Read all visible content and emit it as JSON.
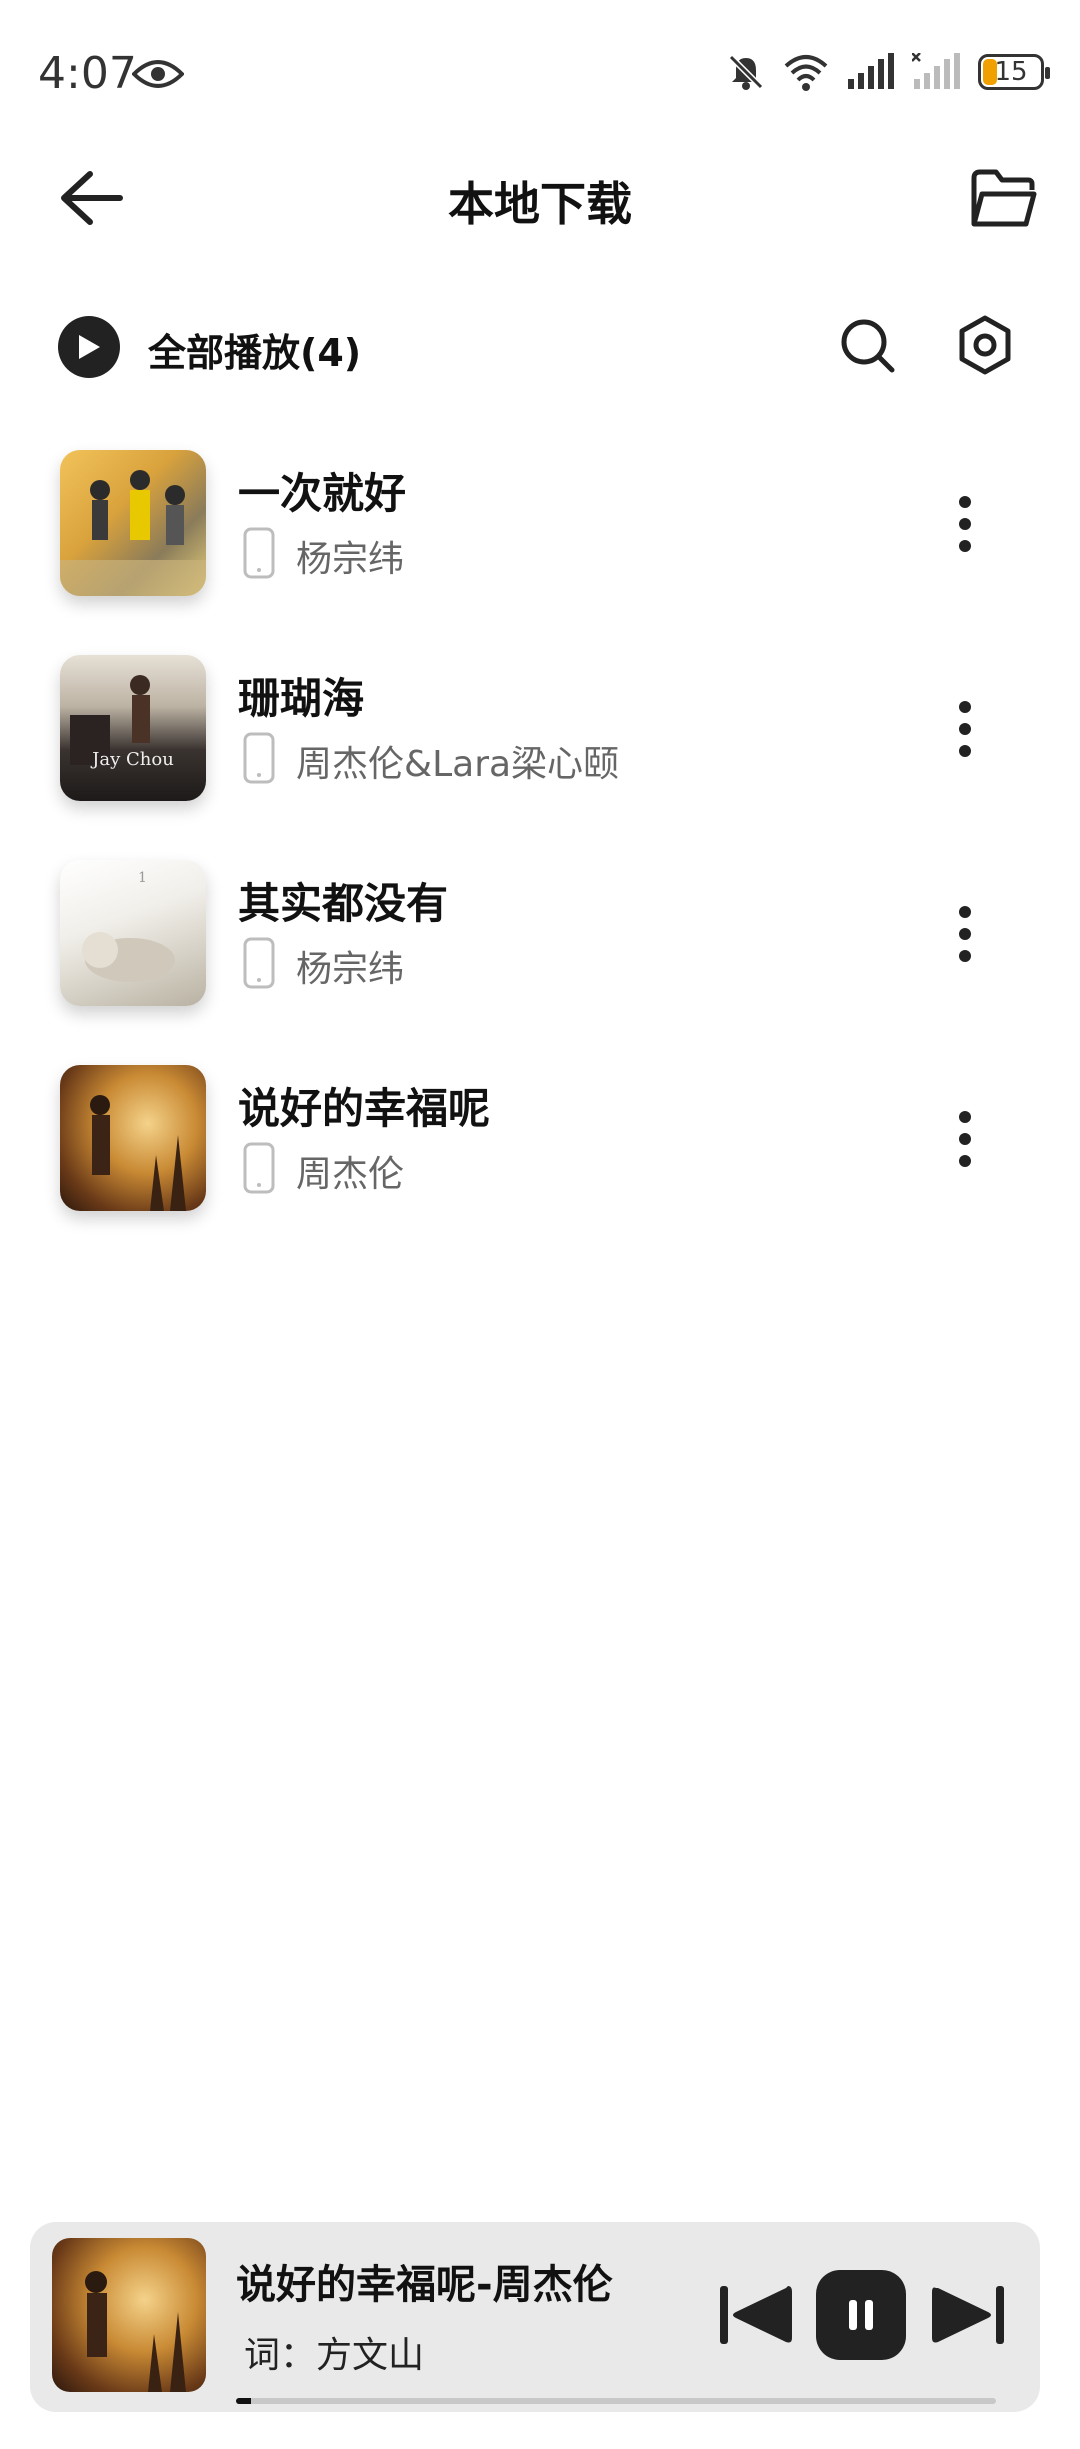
{
  "status_bar": {
    "time": "4:07",
    "battery": "15"
  },
  "header": {
    "title": "本地下载"
  },
  "play_all": {
    "label": "全部播放(4)"
  },
  "songs": [
    {
      "title": "一次就好",
      "artist": "杨宗纬"
    },
    {
      "title": "珊瑚海",
      "artist": "周杰伦&Lara梁心颐"
    },
    {
      "title": "其实都没有",
      "artist": "杨宗纬"
    },
    {
      "title": "说好的幸福呢",
      "artist": "周杰伦"
    }
  ],
  "player": {
    "title": "说好的幸福呢-周杰伦",
    "subtitle": "词：方文山",
    "progress": 0.02
  },
  "colors": {
    "accent": "#222222",
    "battery_level": "#f0a000",
    "player_bg": "#e9e9e9"
  }
}
